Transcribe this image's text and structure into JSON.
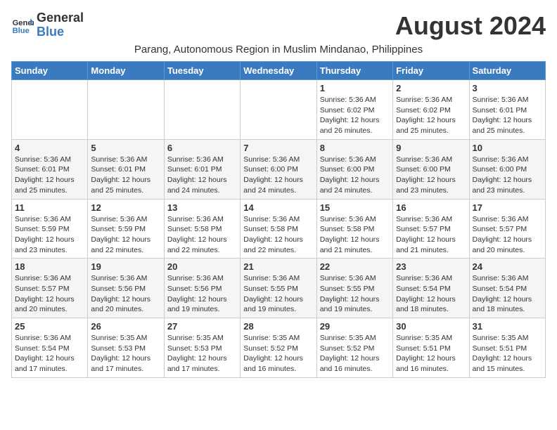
{
  "header": {
    "logo_general": "General",
    "logo_blue": "Blue",
    "month_year": "August 2024",
    "subtitle": "Parang, Autonomous Region in Muslim Mindanao, Philippines"
  },
  "days_of_week": [
    "Sunday",
    "Monday",
    "Tuesday",
    "Wednesday",
    "Thursday",
    "Friday",
    "Saturday"
  ],
  "weeks": [
    [
      {
        "day": "",
        "info": ""
      },
      {
        "day": "",
        "info": ""
      },
      {
        "day": "",
        "info": ""
      },
      {
        "day": "",
        "info": ""
      },
      {
        "day": "1",
        "info": "Sunrise: 5:36 AM\nSunset: 6:02 PM\nDaylight: 12 hours\nand 26 minutes."
      },
      {
        "day": "2",
        "info": "Sunrise: 5:36 AM\nSunset: 6:02 PM\nDaylight: 12 hours\nand 25 minutes."
      },
      {
        "day": "3",
        "info": "Sunrise: 5:36 AM\nSunset: 6:01 PM\nDaylight: 12 hours\nand 25 minutes."
      }
    ],
    [
      {
        "day": "4",
        "info": "Sunrise: 5:36 AM\nSunset: 6:01 PM\nDaylight: 12 hours\nand 25 minutes."
      },
      {
        "day": "5",
        "info": "Sunrise: 5:36 AM\nSunset: 6:01 PM\nDaylight: 12 hours\nand 25 minutes."
      },
      {
        "day": "6",
        "info": "Sunrise: 5:36 AM\nSunset: 6:01 PM\nDaylight: 12 hours\nand 24 minutes."
      },
      {
        "day": "7",
        "info": "Sunrise: 5:36 AM\nSunset: 6:00 PM\nDaylight: 12 hours\nand 24 minutes."
      },
      {
        "day": "8",
        "info": "Sunrise: 5:36 AM\nSunset: 6:00 PM\nDaylight: 12 hours\nand 24 minutes."
      },
      {
        "day": "9",
        "info": "Sunrise: 5:36 AM\nSunset: 6:00 PM\nDaylight: 12 hours\nand 23 minutes."
      },
      {
        "day": "10",
        "info": "Sunrise: 5:36 AM\nSunset: 6:00 PM\nDaylight: 12 hours\nand 23 minutes."
      }
    ],
    [
      {
        "day": "11",
        "info": "Sunrise: 5:36 AM\nSunset: 5:59 PM\nDaylight: 12 hours\nand 23 minutes."
      },
      {
        "day": "12",
        "info": "Sunrise: 5:36 AM\nSunset: 5:59 PM\nDaylight: 12 hours\nand 22 minutes."
      },
      {
        "day": "13",
        "info": "Sunrise: 5:36 AM\nSunset: 5:58 PM\nDaylight: 12 hours\nand 22 minutes."
      },
      {
        "day": "14",
        "info": "Sunrise: 5:36 AM\nSunset: 5:58 PM\nDaylight: 12 hours\nand 22 minutes."
      },
      {
        "day": "15",
        "info": "Sunrise: 5:36 AM\nSunset: 5:58 PM\nDaylight: 12 hours\nand 21 minutes."
      },
      {
        "day": "16",
        "info": "Sunrise: 5:36 AM\nSunset: 5:57 PM\nDaylight: 12 hours\nand 21 minutes."
      },
      {
        "day": "17",
        "info": "Sunrise: 5:36 AM\nSunset: 5:57 PM\nDaylight: 12 hours\nand 20 minutes."
      }
    ],
    [
      {
        "day": "18",
        "info": "Sunrise: 5:36 AM\nSunset: 5:57 PM\nDaylight: 12 hours\nand 20 minutes."
      },
      {
        "day": "19",
        "info": "Sunrise: 5:36 AM\nSunset: 5:56 PM\nDaylight: 12 hours\nand 20 minutes."
      },
      {
        "day": "20",
        "info": "Sunrise: 5:36 AM\nSunset: 5:56 PM\nDaylight: 12 hours\nand 19 minutes."
      },
      {
        "day": "21",
        "info": "Sunrise: 5:36 AM\nSunset: 5:55 PM\nDaylight: 12 hours\nand 19 minutes."
      },
      {
        "day": "22",
        "info": "Sunrise: 5:36 AM\nSunset: 5:55 PM\nDaylight: 12 hours\nand 19 minutes."
      },
      {
        "day": "23",
        "info": "Sunrise: 5:36 AM\nSunset: 5:54 PM\nDaylight: 12 hours\nand 18 minutes."
      },
      {
        "day": "24",
        "info": "Sunrise: 5:36 AM\nSunset: 5:54 PM\nDaylight: 12 hours\nand 18 minutes."
      }
    ],
    [
      {
        "day": "25",
        "info": "Sunrise: 5:36 AM\nSunset: 5:54 PM\nDaylight: 12 hours\nand 17 minutes."
      },
      {
        "day": "26",
        "info": "Sunrise: 5:35 AM\nSunset: 5:53 PM\nDaylight: 12 hours\nand 17 minutes."
      },
      {
        "day": "27",
        "info": "Sunrise: 5:35 AM\nSunset: 5:53 PM\nDaylight: 12 hours\nand 17 minutes."
      },
      {
        "day": "28",
        "info": "Sunrise: 5:35 AM\nSunset: 5:52 PM\nDaylight: 12 hours\nand 16 minutes."
      },
      {
        "day": "29",
        "info": "Sunrise: 5:35 AM\nSunset: 5:52 PM\nDaylight: 12 hours\nand 16 minutes."
      },
      {
        "day": "30",
        "info": "Sunrise: 5:35 AM\nSunset: 5:51 PM\nDaylight: 12 hours\nand 16 minutes."
      },
      {
        "day": "31",
        "info": "Sunrise: 5:35 AM\nSunset: 5:51 PM\nDaylight: 12 hours\nand 15 minutes."
      }
    ]
  ]
}
